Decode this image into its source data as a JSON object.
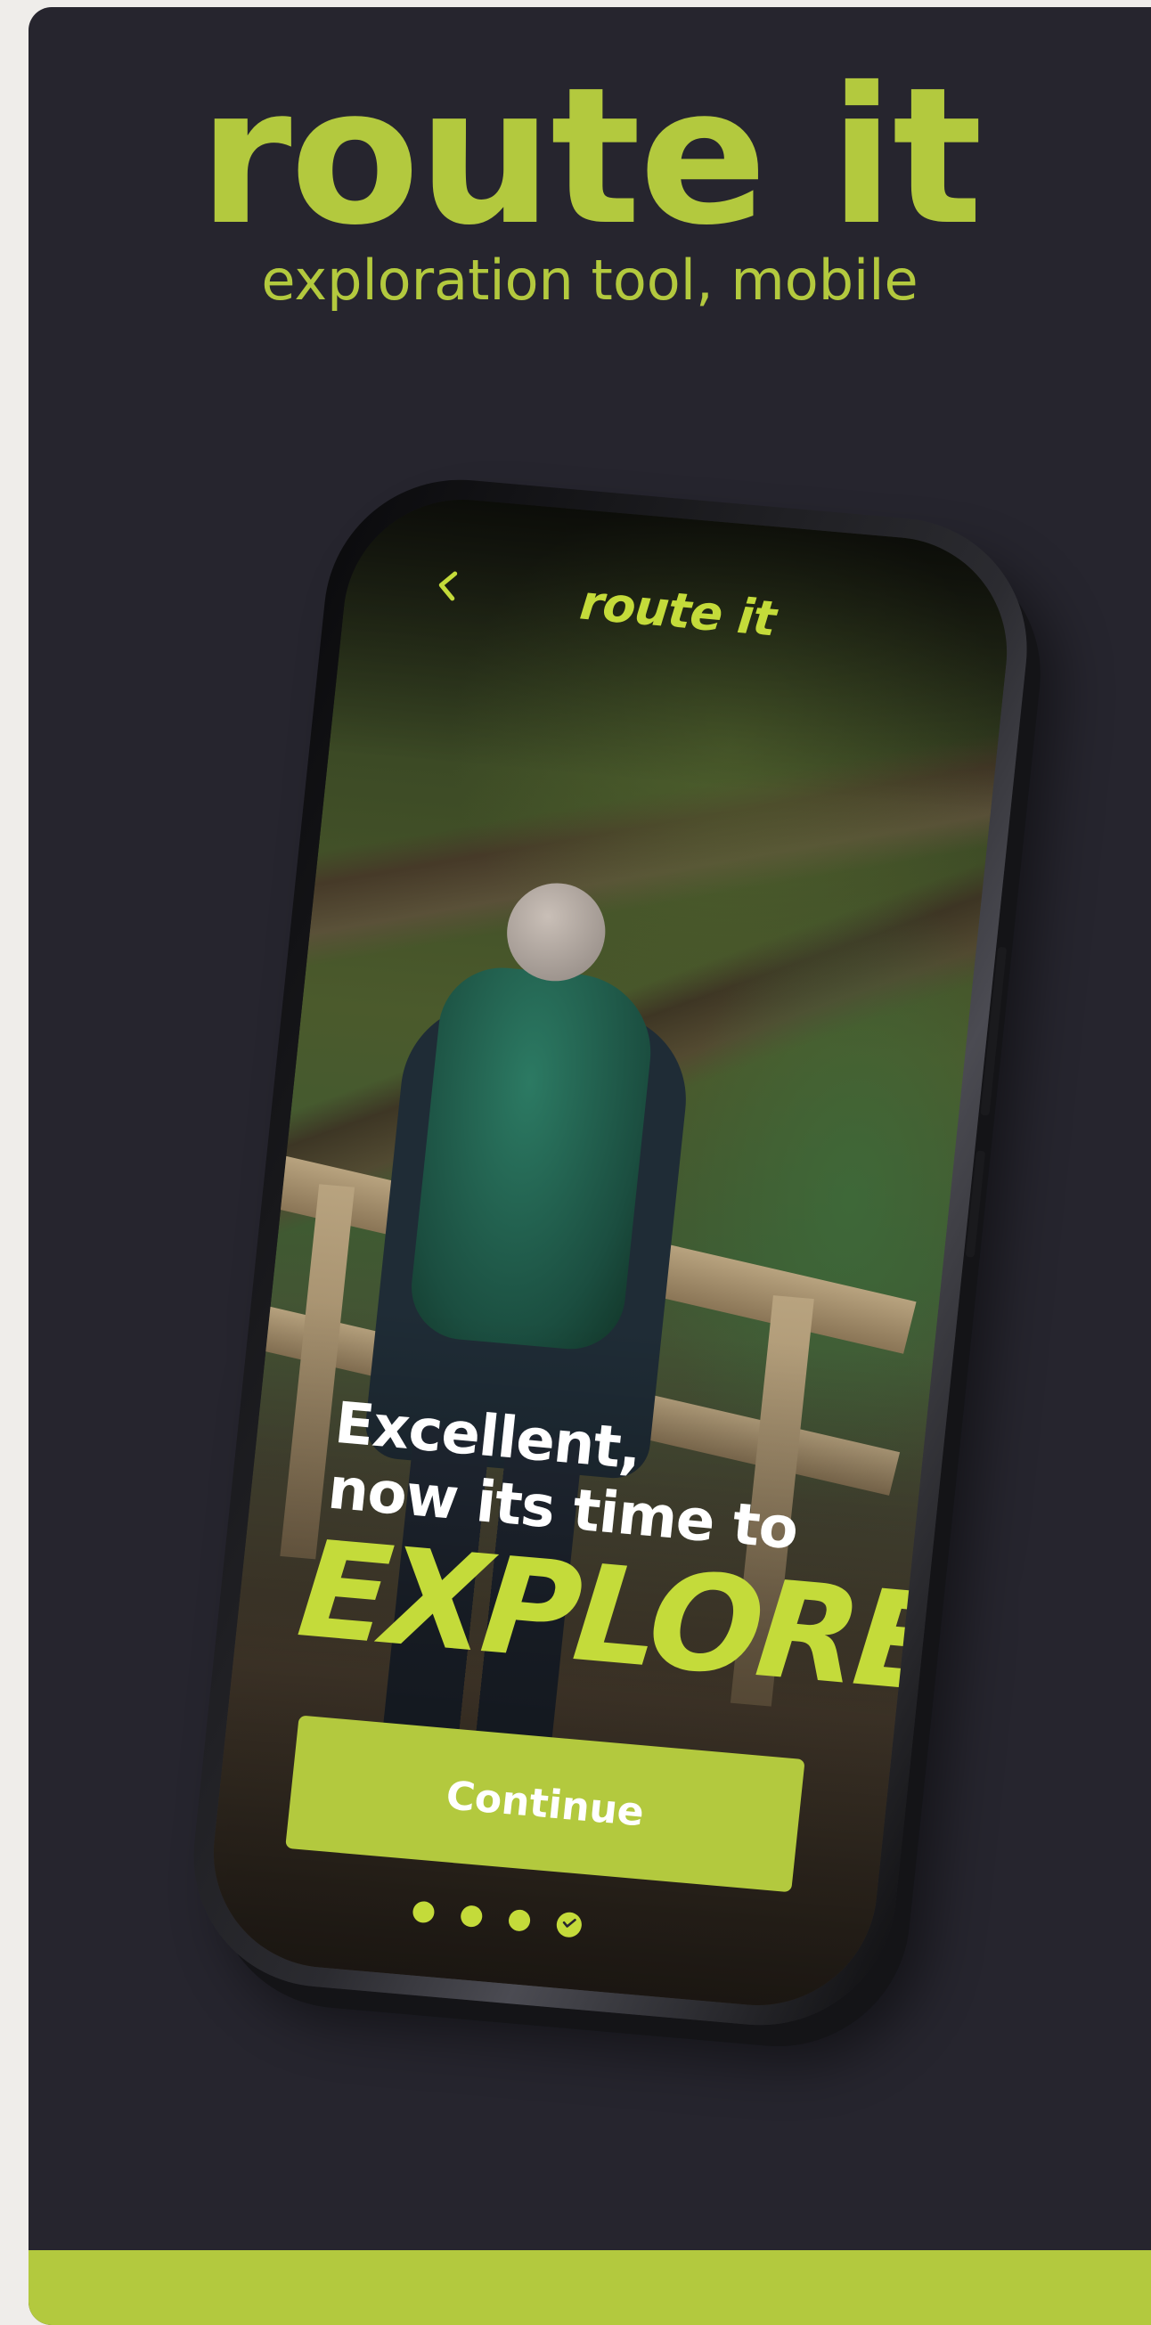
{
  "colors": {
    "background": "#26252e",
    "accent": "#b3c93e",
    "accent_bright": "#c4db3a",
    "page": "#efedea"
  },
  "brand": {
    "title": "route it",
    "subtitle": "exploration tool, mobile"
  },
  "app": {
    "header": {
      "back_icon": "chevron-left-icon",
      "logo": "route it"
    },
    "hero_image": "hiker-on-forest-trail-photo",
    "headline_line1": "Excellent,",
    "headline_line2": "now its time to",
    "headline_emphasis": "EXPLORE",
    "continue_label": "Continue",
    "pager": {
      "total_steps": 4,
      "current_step": 4,
      "completed_icon": "check-icon"
    }
  }
}
